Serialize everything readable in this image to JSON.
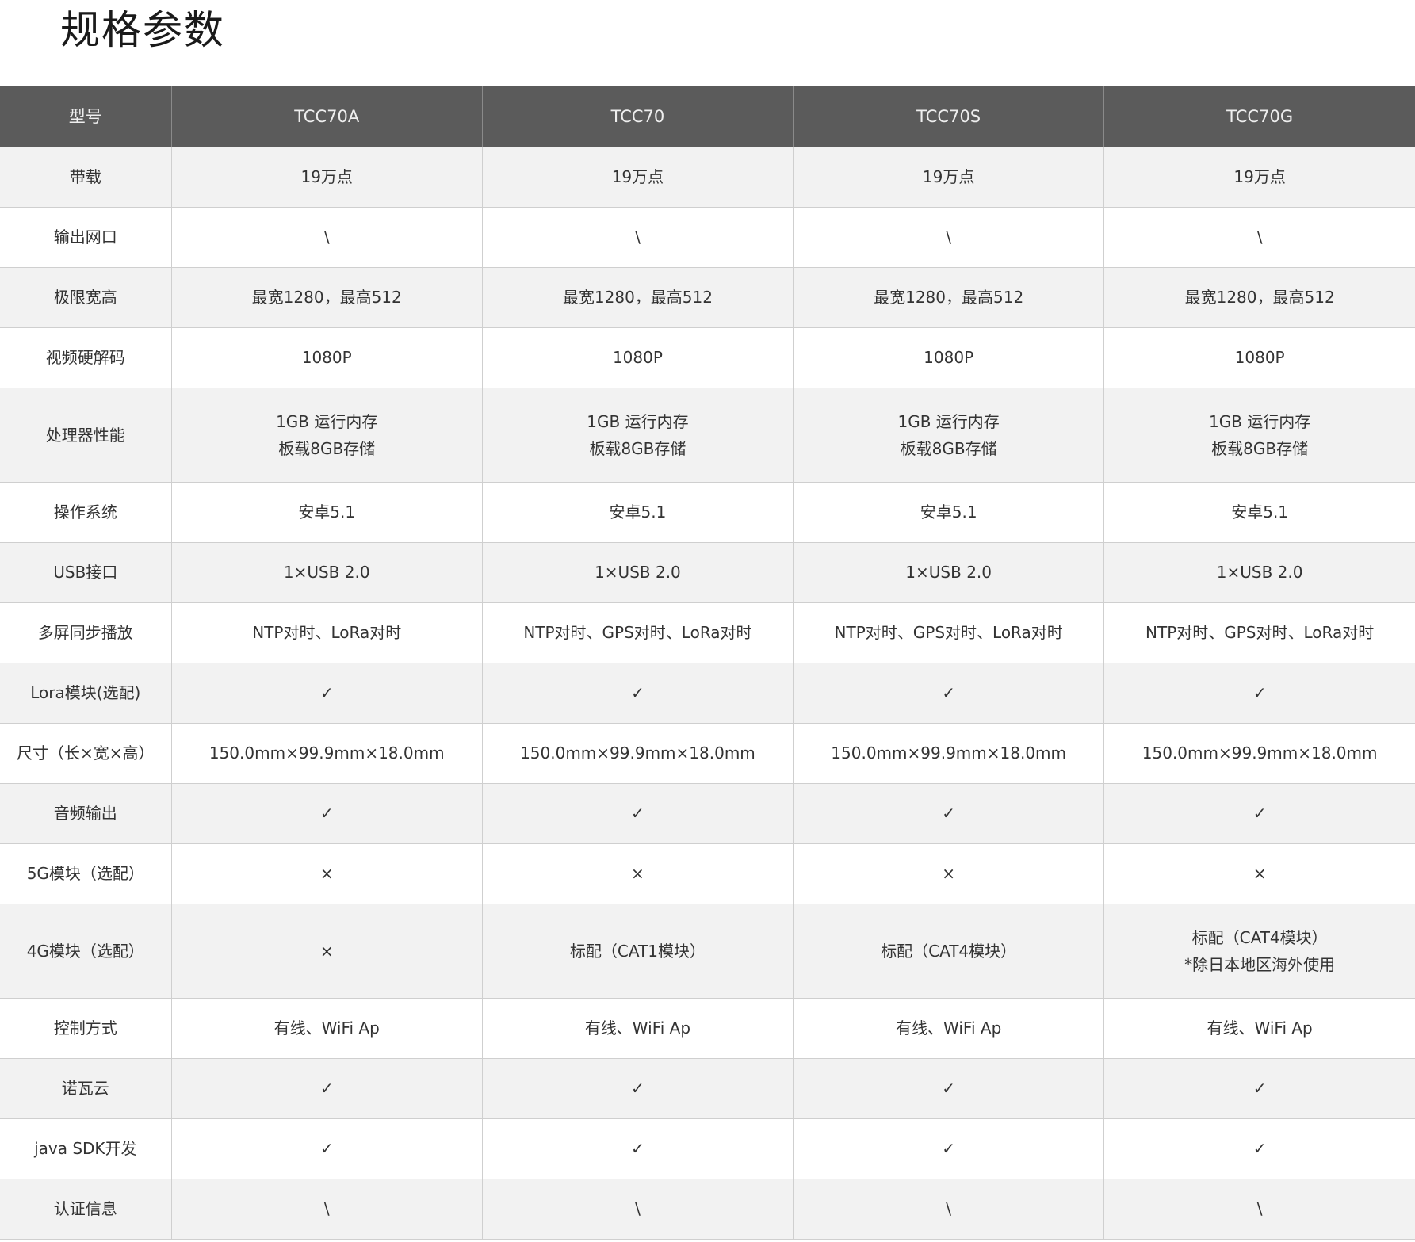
{
  "page": {
    "title": "规格参数"
  },
  "table": {
    "header": {
      "label": "型号",
      "models": [
        "TCC70A",
        "TCC70",
        "TCC70S",
        "TCC70G"
      ]
    },
    "rows": [
      {
        "label": "带载",
        "values": [
          [
            "19万点"
          ],
          [
            "19万点"
          ],
          [
            "19万点"
          ],
          [
            "19万点"
          ]
        ]
      },
      {
        "label": "输出网口",
        "values": [
          [
            "\\"
          ],
          [
            "\\"
          ],
          [
            "\\"
          ],
          [
            "\\"
          ]
        ]
      },
      {
        "label": "极限宽高",
        "values": [
          [
            "最宽1280，最高512"
          ],
          [
            "最宽1280，最高512"
          ],
          [
            "最宽1280，最高512"
          ],
          [
            "最宽1280，最高512"
          ]
        ]
      },
      {
        "label": "视频硬解码",
        "values": [
          [
            "1080P"
          ],
          [
            "1080P"
          ],
          [
            "1080P"
          ],
          [
            "1080P"
          ]
        ]
      },
      {
        "label": "处理器性能",
        "values": [
          [
            "1GB 运行内存",
            "板载8GB存储"
          ],
          [
            "1GB 运行内存",
            "板载8GB存储"
          ],
          [
            "1GB 运行内存",
            "板载8GB存储"
          ],
          [
            "1GB 运行内存",
            "板载8GB存储"
          ]
        ]
      },
      {
        "label": "操作系统",
        "values": [
          [
            "安卓5.1"
          ],
          [
            "安卓5.1"
          ],
          [
            "安卓5.1"
          ],
          [
            "安卓5.1"
          ]
        ]
      },
      {
        "label": "USB接口",
        "values": [
          [
            "1×USB 2.0"
          ],
          [
            "1×USB 2.0"
          ],
          [
            "1×USB 2.0"
          ],
          [
            "1×USB 2.0"
          ]
        ]
      },
      {
        "label": "多屏同步播放",
        "values": [
          [
            "NTP对时、LoRa对时"
          ],
          [
            "NTP对时、GPS对时、LoRa对时"
          ],
          [
            "NTP对时、GPS对时、LoRa对时"
          ],
          [
            "NTP对时、GPS对时、LoRa对时"
          ]
        ]
      },
      {
        "label": "Lora模块(选配)",
        "values": [
          [
            "✓"
          ],
          [
            "✓"
          ],
          [
            "✓"
          ],
          [
            "✓"
          ]
        ]
      },
      {
        "label": "尺寸（长×宽×高）",
        "values": [
          [
            "150.0mm×99.9mm×18.0mm"
          ],
          [
            "150.0mm×99.9mm×18.0mm"
          ],
          [
            "150.0mm×99.9mm×18.0mm"
          ],
          [
            "150.0mm×99.9mm×18.0mm"
          ]
        ]
      },
      {
        "label": "音频输出",
        "values": [
          [
            "✓"
          ],
          [
            "✓"
          ],
          [
            "✓"
          ],
          [
            "✓"
          ]
        ]
      },
      {
        "label": "5G模块（选配）",
        "values": [
          [
            "×"
          ],
          [
            "×"
          ],
          [
            "×"
          ],
          [
            "×"
          ]
        ]
      },
      {
        "label": "4G模块（选配）",
        "values": [
          [
            "×"
          ],
          [
            "标配（CAT1模块）"
          ],
          [
            "标配（CAT4模块）"
          ],
          [
            "标配（CAT4模块）",
            "*除日本地区海外使用"
          ]
        ]
      },
      {
        "label": "控制方式",
        "values": [
          [
            "有线、WiFi Ap"
          ],
          [
            "有线、WiFi Ap"
          ],
          [
            "有线、WiFi Ap"
          ],
          [
            "有线、WiFi Ap"
          ]
        ]
      },
      {
        "label": "诺瓦云",
        "values": [
          [
            "✓"
          ],
          [
            "✓"
          ],
          [
            "✓"
          ],
          [
            "✓"
          ]
        ]
      },
      {
        "label": "java SDK开发",
        "values": [
          [
            "✓"
          ],
          [
            "✓"
          ],
          [
            "✓"
          ],
          [
            "✓"
          ]
        ]
      },
      {
        "label": "认证信息",
        "values": [
          [
            "\\"
          ],
          [
            "\\"
          ],
          [
            "\\"
          ],
          [
            "\\"
          ]
        ]
      }
    ]
  },
  "colors": {
    "header_bg": "#5b5b5b",
    "header_text": "#eeeeee",
    "row_alt_bg": "#f2f2f2",
    "row_bg": "#ffffff",
    "grid_line": "#cfcfcf"
  }
}
